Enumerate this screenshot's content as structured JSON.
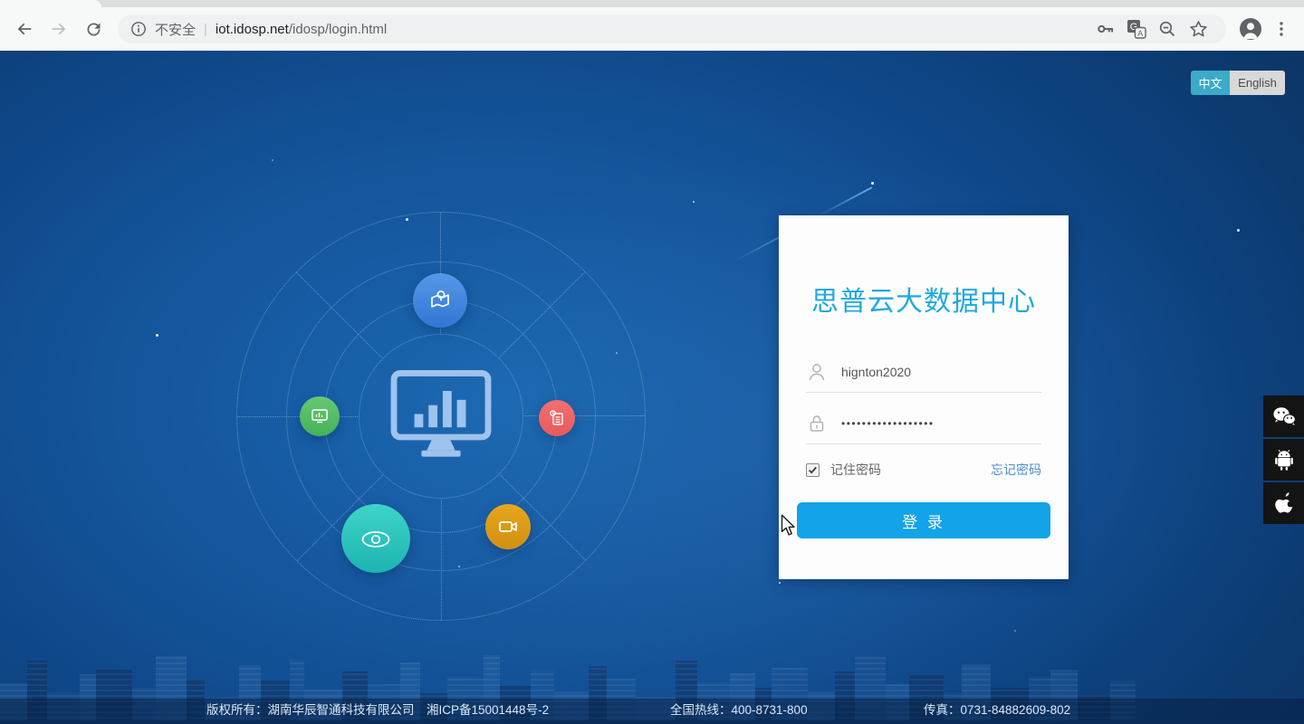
{
  "browser": {
    "security_label": "不安全",
    "separator": "|",
    "url_host": "iot.idosp.net",
    "url_path": "/idosp/login.html",
    "icons": {
      "back": "arrow-left",
      "forward": "arrow-right",
      "reload": "refresh",
      "page_info": "info-circle",
      "saved_password": "key",
      "translate": "google-translate",
      "zoom_out": "magnifier-minus",
      "bookmark": "star-outline",
      "profile": "avatar-person",
      "menu": "three-dots-vertical"
    }
  },
  "header": {
    "lang_zh": "中文",
    "lang_en": "English"
  },
  "login": {
    "title": "思普云大数据中心",
    "username": "hignton2020",
    "password_mask": "••••••••••••••••••",
    "remember_label": "记住密码",
    "remember_checked": true,
    "forgot_label": "忘记密码",
    "submit_label": "登 录",
    "icons": {
      "username": "person-outline",
      "password": "lock-outline"
    }
  },
  "graphic": {
    "center_icon": "monitor-bar-chart",
    "satellites": [
      "map-location",
      "device-monitor",
      "report-document",
      "eye-monitoring",
      "video-camera"
    ]
  },
  "sideapps": {
    "icons": [
      "wechat",
      "android",
      "apple"
    ]
  },
  "footer": {
    "copyright": "版权所有：湖南华辰智通科技有限公司　湘ICP备15001448号-2",
    "hotline": "全国热线：400-8731-800",
    "fax": "传真：0731-84882609-802"
  },
  "colors": {
    "accent_button": "#12a3e8",
    "title_blue": "#1fa9e0",
    "link_blue": "#4a90d2",
    "lang_active": "#3caac9",
    "bg_navy": "#0c3a70"
  }
}
